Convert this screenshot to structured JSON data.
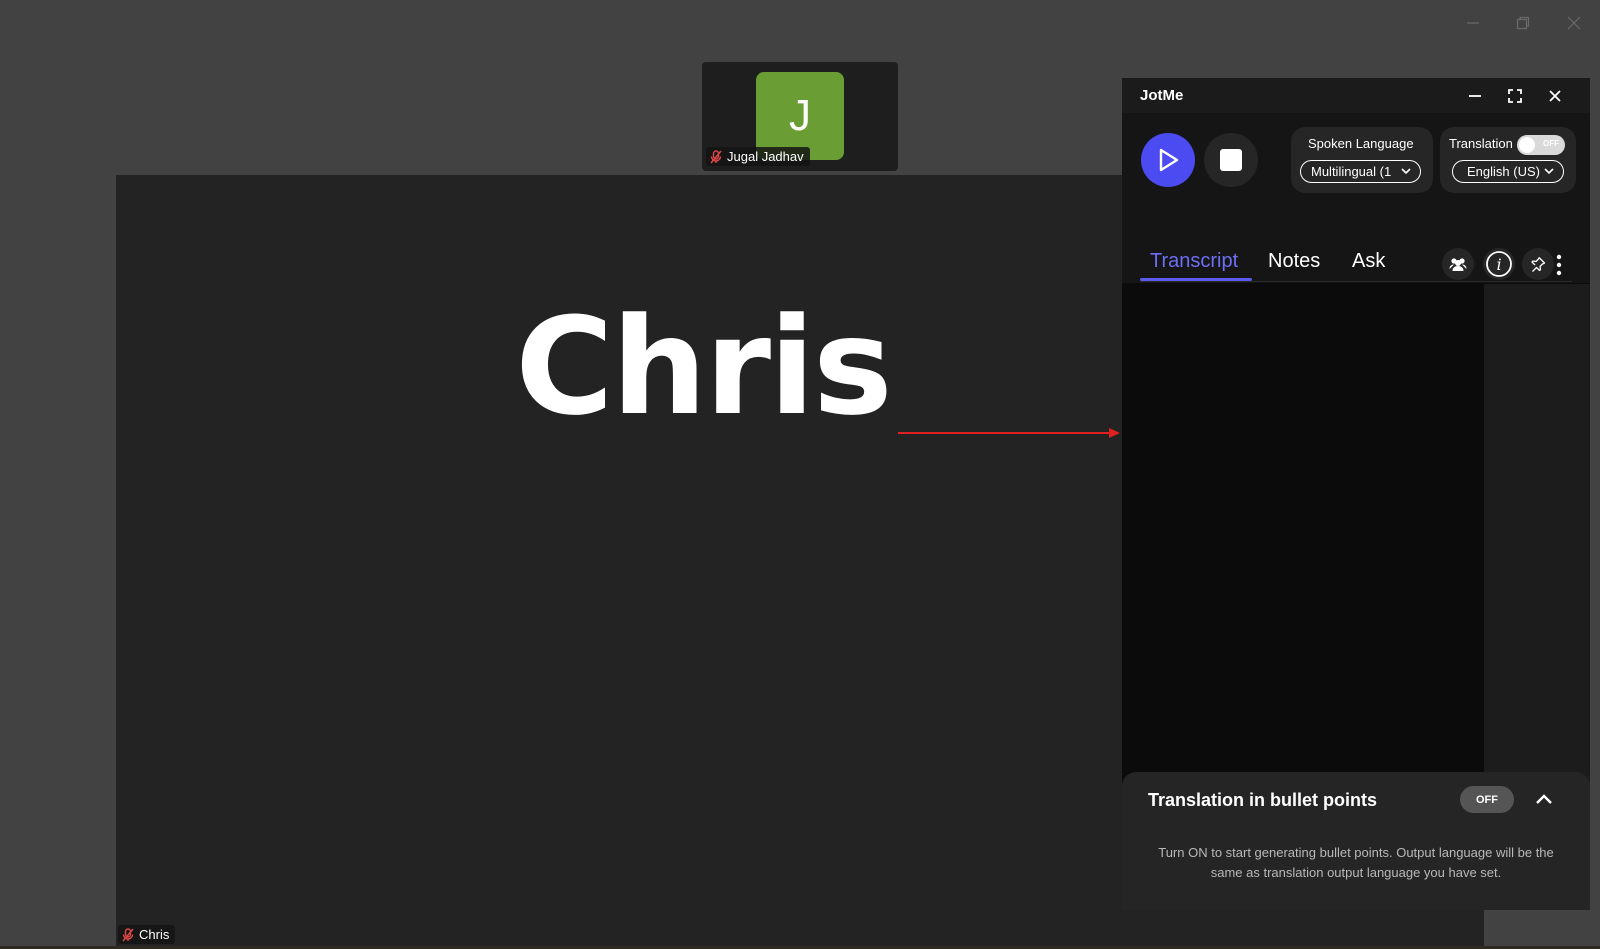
{
  "meeting": {
    "thumbnail": {
      "initial": "J",
      "name": "Jugal Jadhav"
    },
    "main_participant": {
      "display_name": "Chris",
      "tag_name": "Chris"
    }
  },
  "jotme": {
    "title": "JotMe",
    "spoken_language": {
      "label": "Spoken Language",
      "value": "Multilingual (1"
    },
    "translation": {
      "label": "Translation",
      "toggle_text": "OFF",
      "value": "English (US)"
    },
    "tabs": [
      {
        "label": "Transcript",
        "active": true
      },
      {
        "label": "Notes",
        "active": false
      },
      {
        "label": "Ask",
        "active": false
      }
    ],
    "bullet_points": {
      "title": "Translation in bullet points",
      "toggle_text": "OFF",
      "description": "Turn ON to start generating bullet points. Output language will be the same as translation output language you have set."
    }
  },
  "colors": {
    "accent": "#4b4bf1",
    "avatar": "#6a9e34",
    "arrow": "#e02020"
  }
}
